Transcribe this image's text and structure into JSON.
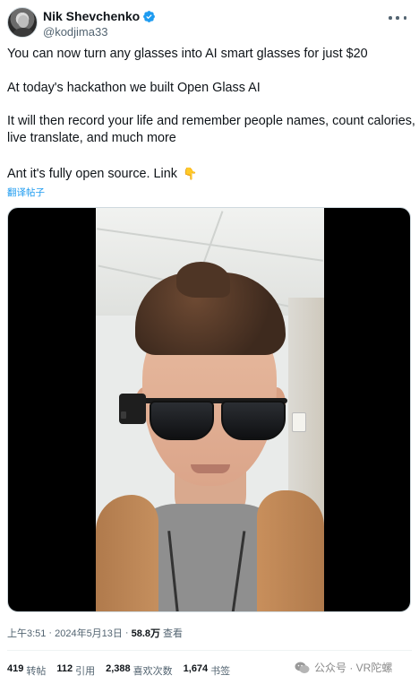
{
  "author": {
    "name": "Nik Shevchenko",
    "handle": "@kodjima33",
    "verified": true
  },
  "tweet": {
    "paragraphs": [
      "You can now turn any glasses into AI smart glasses for just $20",
      "At today's hackathon we built Open Glass AI",
      "It will then record your life and remember people names,  count calories, live translate, and much more",
      "Ant it's fully open source. Link"
    ],
    "emoji": "👇",
    "translate_link": "翻译帖子"
  },
  "meta": {
    "time": "上午3:51",
    "separator": "·",
    "date": "2024年5月13日",
    "views_count": "58.8万",
    "views_label": "查看"
  },
  "stats": {
    "reposts": {
      "count": "419",
      "label": "转帖"
    },
    "quotes": {
      "count": "112",
      "label": "引用"
    },
    "likes": {
      "count": "2,388",
      "label": "喜欢次数"
    },
    "bookmarks": {
      "count": "1,674",
      "label": "书签"
    }
  },
  "watermark": {
    "text": "公众号 · VR陀螺",
    "icon": "wechat-icon"
  },
  "colors": {
    "link": "#1d9bf0",
    "verified": "#1d9bf0",
    "text": "#0f1419",
    "secondary": "#536471"
  }
}
